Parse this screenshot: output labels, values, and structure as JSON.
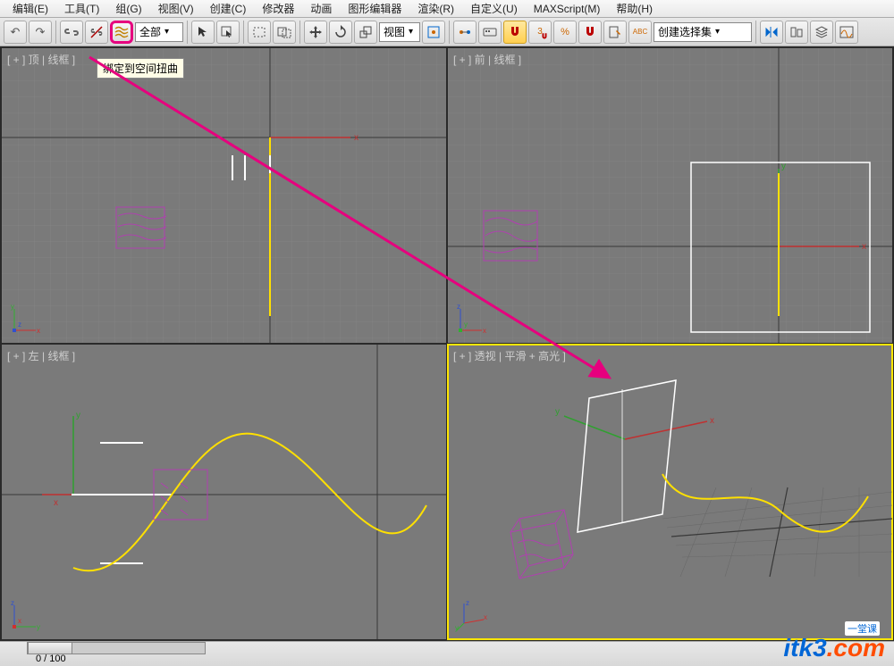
{
  "menu": {
    "items": [
      "编辑(E)",
      "工具(T)",
      "组(G)",
      "视图(V)",
      "创建(C)",
      "修改器",
      "动画",
      "图形编辑器",
      "渲染(R)",
      "自定义(U)",
      "MAXScript(M)",
      "帮助(H)"
    ]
  },
  "toolbar": {
    "filter_label": "全部",
    "coord_label": "视图",
    "axis_center_label": "3",
    "selection_set_label": "创建选择集",
    "percent": "%"
  },
  "tooltip": "绑定到空间扭曲",
  "viewports": {
    "top": {
      "label": "[ + ] 顶 | 线框 ]"
    },
    "front": {
      "label": "[ + ] 前 | 线框 ]"
    },
    "left": {
      "label": "[ + ] 左 | 线框 ]"
    },
    "persp": {
      "label": "[ + ] 透视 | 平滑 + 高光 ]"
    }
  },
  "timeline": {
    "frame": "0 / 100"
  },
  "watermark": {
    "brand1": "itk3",
    "brand2": ".com",
    "sub": "一堂课"
  }
}
